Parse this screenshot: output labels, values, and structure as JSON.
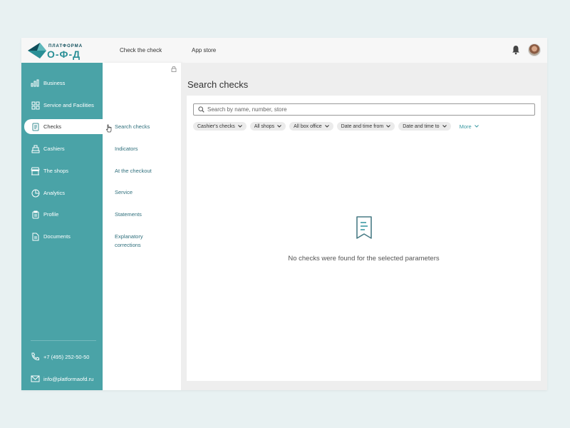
{
  "header": {
    "logo_small": "ПЛАТФОРМА",
    "logo_big": "О-Ф-Д",
    "nav": [
      {
        "label": "Check the check"
      },
      {
        "label": "App store"
      }
    ],
    "icons": [
      "bell-icon",
      "user-avatar"
    ]
  },
  "sidebar": {
    "items": [
      {
        "label": "Business",
        "icon": "bar-chart-icon"
      },
      {
        "label": "Service and Facilities",
        "icon": "grid-icon"
      },
      {
        "label": "Checks",
        "icon": "receipt-icon",
        "active": true
      },
      {
        "label": "Cashiers",
        "icon": "cash-register-icon"
      },
      {
        "label": "The shops",
        "icon": "store-icon"
      },
      {
        "label": "Analytics",
        "icon": "pie-chart-icon"
      },
      {
        "label": "Profile",
        "icon": "clipboard-icon"
      },
      {
        "label": "Documents",
        "icon": "document-icon"
      }
    ],
    "phone": "+7 (495) 252-50-50",
    "email": "info@platformaofd.ru"
  },
  "submenu": {
    "items": [
      {
        "label": "Search checks",
        "active": true
      },
      {
        "label": "Indicators"
      },
      {
        "label": "At the checkout"
      },
      {
        "label": "Service"
      },
      {
        "label": "Statements"
      },
      {
        "label": "Explanatory"
      },
      {
        "label": "corrections"
      }
    ]
  },
  "main": {
    "title": "Search checks",
    "search": {
      "placeholder": "Search by name, number, store",
      "value": ""
    },
    "filters": [
      {
        "label": "Cashier's checks"
      },
      {
        "label": "All shops"
      },
      {
        "label": "All box office"
      },
      {
        "label": "Date and time from"
      },
      {
        "label": "Date and time to"
      }
    ],
    "more_label": "More",
    "empty_message": "No checks were found for the selected parameters"
  },
  "colors": {
    "accent": "#4aa3a7",
    "link": "#2f6f7c",
    "logo_dark": "#0e4d5a"
  }
}
